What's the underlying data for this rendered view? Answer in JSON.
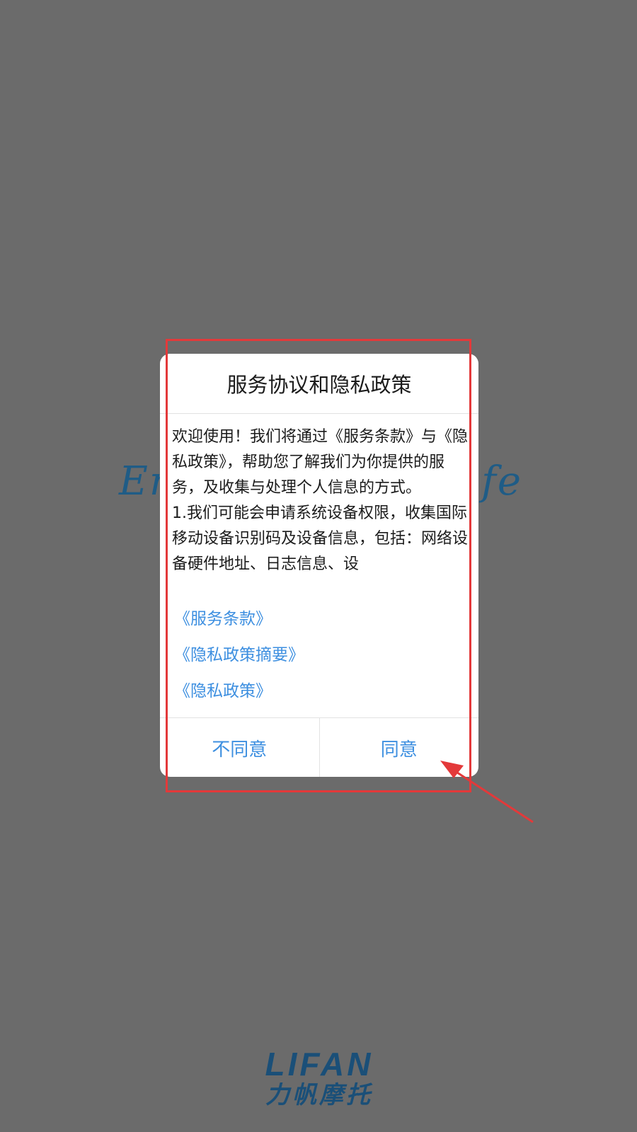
{
  "splash": {
    "slogan_left": "En",
    "slogan_right": "ife"
  },
  "brand": {
    "name_en": "LIFAN",
    "name_cn": "力帆摩托"
  },
  "dialog": {
    "title": "服务协议和隐私政策",
    "body_paragraphs": [
      "欢迎使用！我们将通过《服务条款》与《隐私政策》，帮助您了解我们为你提供的服务，及收集与处理个人信息的方式。",
      "1.我们可能会申请系统设备权限，收集国际移动设备识别码及设备信息，包括：网络设备硬件地址、日志信息、设"
    ],
    "links": [
      "《服务条款》",
      "《隐私政策摘要》",
      "《隐私政策》"
    ],
    "disagree_label": "不同意",
    "agree_label": "同意"
  },
  "annotation": {
    "highlight_color": "#e3393a"
  },
  "colors": {
    "link": "#3d8fe0",
    "overlay": "#6b6b6b",
    "brand": "#1a4f78"
  }
}
